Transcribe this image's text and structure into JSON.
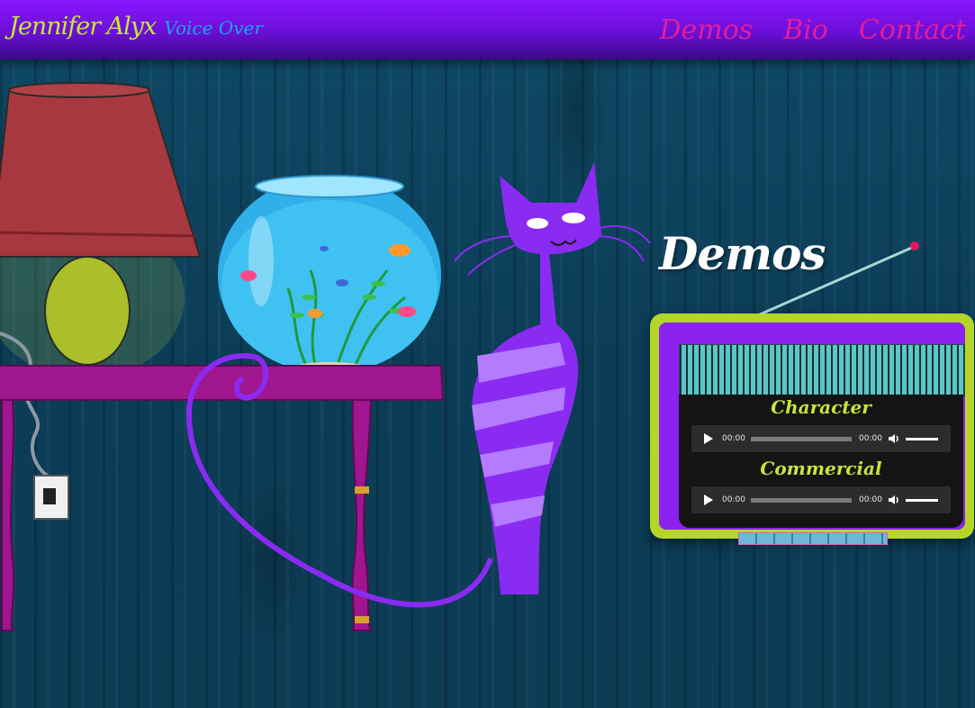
{
  "header": {
    "brand_name": "Jennifer Alyx",
    "brand_subtitle": "Voice Over",
    "nav": [
      {
        "label": "Demos"
      },
      {
        "label": "Bio"
      },
      {
        "label": "Contact"
      }
    ]
  },
  "hero": {
    "section_title": "Demos"
  },
  "players": [
    {
      "label": "Character",
      "current_time": "00:00",
      "duration": "00:00",
      "progress": 0,
      "volume": 1.0
    },
    {
      "label": "Commercial",
      "current_time": "00:00",
      "duration": "00:00",
      "progress": 0,
      "volume": 1.0
    }
  ],
  "colors": {
    "topbar": "#7a12f0",
    "brand_name": "#c7e63a",
    "brand_subtitle": "#1aa6e8",
    "nav_link": "#e21e9a",
    "radio_frame": "#b5d629",
    "radio_body": "#8b22f0",
    "cat": "#8a2bf2",
    "shelf": "#a0168f"
  },
  "icons": [
    "play-icon",
    "volume-icon"
  ]
}
